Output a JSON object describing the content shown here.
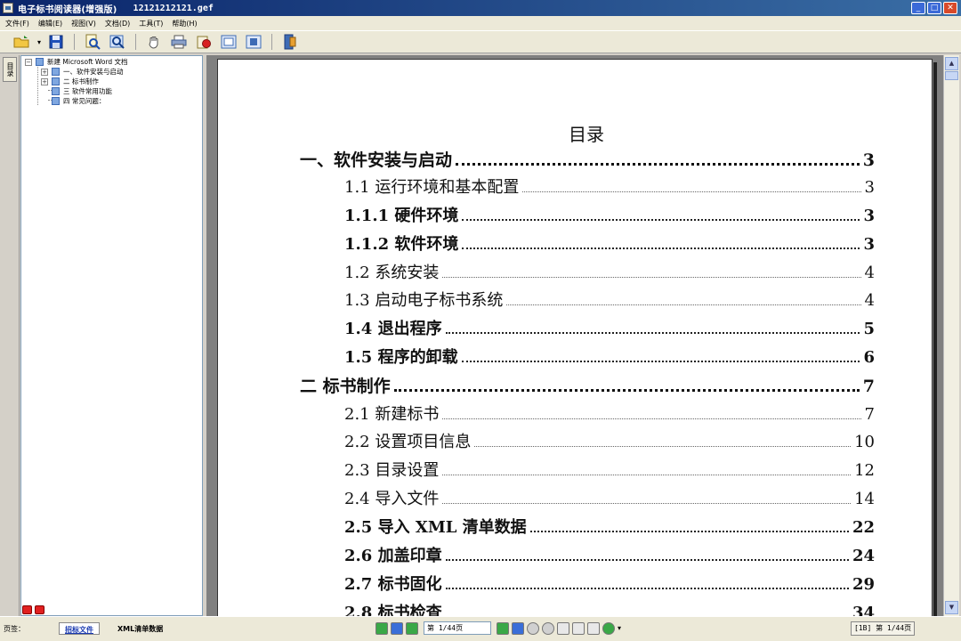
{
  "window": {
    "title": "电子标书阅读器(增强版)",
    "file_name": "12121212121.gef"
  },
  "menu": [
    {
      "label": "文件(F)"
    },
    {
      "label": "编辑(E)"
    },
    {
      "label": "视图(V)"
    },
    {
      "label": "文档(D)"
    },
    {
      "label": "工具(T)"
    },
    {
      "label": "帮助(H)"
    }
  ],
  "left_panel": {
    "tab_label": "目录",
    "tree": {
      "root": "新建 Microsoft Word 文档",
      "items": [
        {
          "label": "一、软件安装与启动",
          "expandable": true
        },
        {
          "label": "二 标书制作",
          "expandable": true
        },
        {
          "label": "三 软件常用功能",
          "expandable": false
        },
        {
          "label": "四 常见问题：",
          "expandable": false
        }
      ]
    }
  },
  "document": {
    "toc_title": "目录",
    "toc": [
      {
        "text": "一、软件安装与启动",
        "page": "3"
      },
      {
        "text": "1.1 运行环境和基本配置",
        "page": "3"
      },
      {
        "text": "1.1.1 硬件环境",
        "page": "3"
      },
      {
        "text": "1.1.2 软件环境",
        "page": "3"
      },
      {
        "text": "1.2 系统安装",
        "page": "4"
      },
      {
        "text": "1.3 启动电子标书系统",
        "page": "4"
      },
      {
        "text": "1.4 退出程序",
        "page": "5"
      },
      {
        "text": "1.5 程序的卸载",
        "page": "6"
      },
      {
        "text": "二  标书制作",
        "page": "7"
      },
      {
        "text": "2.1 新建标书",
        "page": "7"
      },
      {
        "text": "2.2 设置项目信息",
        "page": "10"
      },
      {
        "text": "2.3 目录设置",
        "page": "12"
      },
      {
        "text": "2.4 导入文件",
        "page": "14"
      },
      {
        "text": "2.5 导入 XML 清单数据",
        "page": "22"
      },
      {
        "text": "2.6 加盖印章",
        "page": "24"
      },
      {
        "text": "2.7 标书固化",
        "page": "29"
      },
      {
        "text": "2.8 标书检查",
        "page": "34"
      }
    ]
  },
  "statusbar": {
    "page_label": "页签：",
    "tabs": [
      {
        "label": "招标文件",
        "active": true
      },
      {
        "label": "XML清单数据",
        "active": false
      }
    ],
    "page_input": "第 1/44页",
    "page_indicator": "[1B] 第 1/44页"
  },
  "icons": {
    "toolbar": [
      "open-folder-icon",
      "dropdown-arrow-icon",
      "save-icon",
      "search-document-icon",
      "find-icon",
      "hand-tool-icon",
      "print-icon",
      "stamp-icon",
      "view-icon",
      "page-view-icon",
      "exit-icon"
    ]
  }
}
